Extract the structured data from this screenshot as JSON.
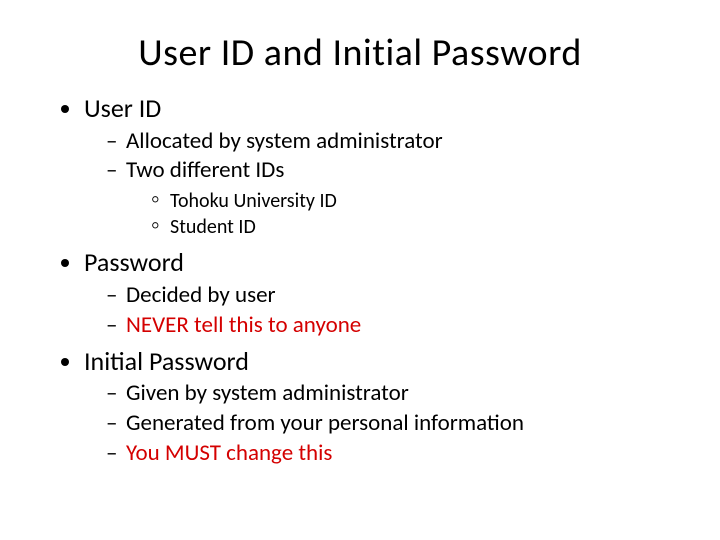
{
  "title": "User ID and Initial Password",
  "sections": [
    {
      "heading": "User ID",
      "items": [
        {
          "text": "Allocated by system administrator"
        },
        {
          "text": "Two different IDs",
          "subitems": [
            {
              "text": "Tohoku University ID"
            },
            {
              "text": "Student ID"
            }
          ]
        }
      ]
    },
    {
      "heading": "Password",
      "items": [
        {
          "text": "Decided by user"
        },
        {
          "text": "NEVER tell this to anyone",
          "emphasis": "red"
        }
      ]
    },
    {
      "heading": "Initial Password",
      "items": [
        {
          "text": "Given by system administrator"
        },
        {
          "text": "Generated from your personal information"
        },
        {
          "text": "You MUST change this",
          "emphasis": "red"
        }
      ]
    }
  ]
}
